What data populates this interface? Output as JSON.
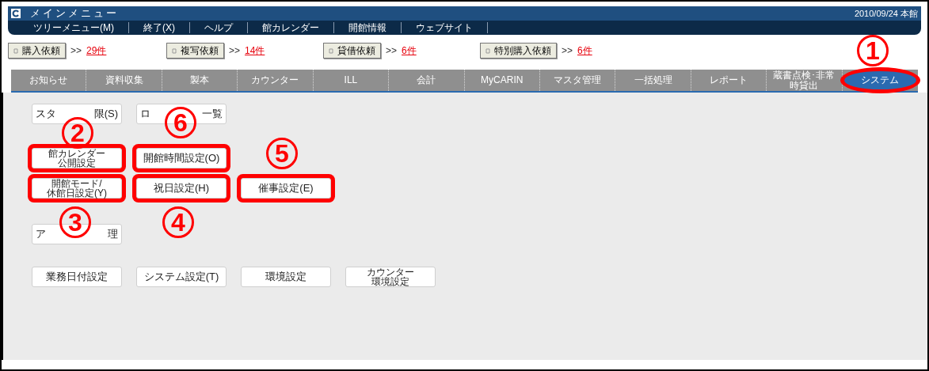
{
  "window": {
    "title": "メインメニュー",
    "date": "2010/09/24 本館"
  },
  "menu": [
    "ツリーメニュー(M)",
    "終了(X)",
    "ヘルプ",
    "館カレンダー",
    "開館情報",
    "ウェブサイト"
  ],
  "requests": [
    {
      "label": "購入依頼",
      "arrow": ">>",
      "count": "29件"
    },
    {
      "label": "複写依頼",
      "arrow": ">>",
      "count": "14件"
    },
    {
      "label": "貸借依頼",
      "arrow": ">>",
      "count": "6件"
    },
    {
      "label": "特別購入依頼",
      "arrow": ">>",
      "count": "6件"
    }
  ],
  "tabs": [
    {
      "label": "お知らせ",
      "selected": false,
      "highlighted": false
    },
    {
      "label": "資料収集",
      "selected": false,
      "highlighted": false
    },
    {
      "label": "製本",
      "selected": false,
      "highlighted": false
    },
    {
      "label": "カウンター",
      "selected": false,
      "highlighted": false
    },
    {
      "label": "ILL",
      "selected": false,
      "highlighted": false
    },
    {
      "label": "会計",
      "selected": false,
      "highlighted": false
    },
    {
      "label": "MyCARIN",
      "selected": false,
      "highlighted": false
    },
    {
      "label": "マスタ管理",
      "selected": false,
      "highlighted": false
    },
    {
      "label": "一括処理",
      "selected": false,
      "highlighted": false
    },
    {
      "label": "レポート",
      "selected": false,
      "highlighted": false
    },
    {
      "label": "蔵書点検･非常時貸出",
      "selected": false,
      "highlighted": false
    },
    {
      "label": "システム",
      "selected": true,
      "highlighted": true
    }
  ],
  "button_rows": [
    [
      {
        "kind": "covered",
        "parts": [
          "スタ",
          "限(S)"
        ],
        "highlighted": false
      },
      {
        "kind": "covered",
        "parts": [
          "ロ",
          "一覧"
        ],
        "highlighted": false
      }
    ],
    [
      {
        "kind": "stacked",
        "parts": [
          "館カレンダー",
          "公開設定"
        ],
        "highlighted": true
      },
      {
        "kind": "plain",
        "parts": [
          "開館時間設定(O)"
        ],
        "highlighted": true
      }
    ],
    [
      {
        "kind": "stacked",
        "parts": [
          "開館モード/",
          "休館日設定(Y)"
        ],
        "highlighted": true
      },
      {
        "kind": "plain",
        "parts": [
          "祝日設定(H)"
        ],
        "highlighted": true
      },
      {
        "kind": "plain",
        "parts": [
          "催事設定(E)"
        ],
        "highlighted": true
      }
    ],
    [
      {
        "kind": "covered",
        "parts": [
          "ア",
          "理"
        ],
        "highlighted": false
      }
    ],
    [
      {
        "kind": "plain",
        "parts": [
          "業務日付設定"
        ],
        "highlighted": false
      },
      {
        "kind": "plain",
        "parts": [
          "システム設定(T)"
        ],
        "highlighted": false
      },
      {
        "kind": "plain",
        "parts": [
          "環境設定"
        ],
        "highlighted": false
      },
      {
        "kind": "stacked",
        "parts": [
          "カウンター",
          "環境設定"
        ],
        "highlighted": false
      }
    ]
  ],
  "callouts": [
    "1",
    "2",
    "6",
    "5",
    "3",
    "4"
  ]
}
